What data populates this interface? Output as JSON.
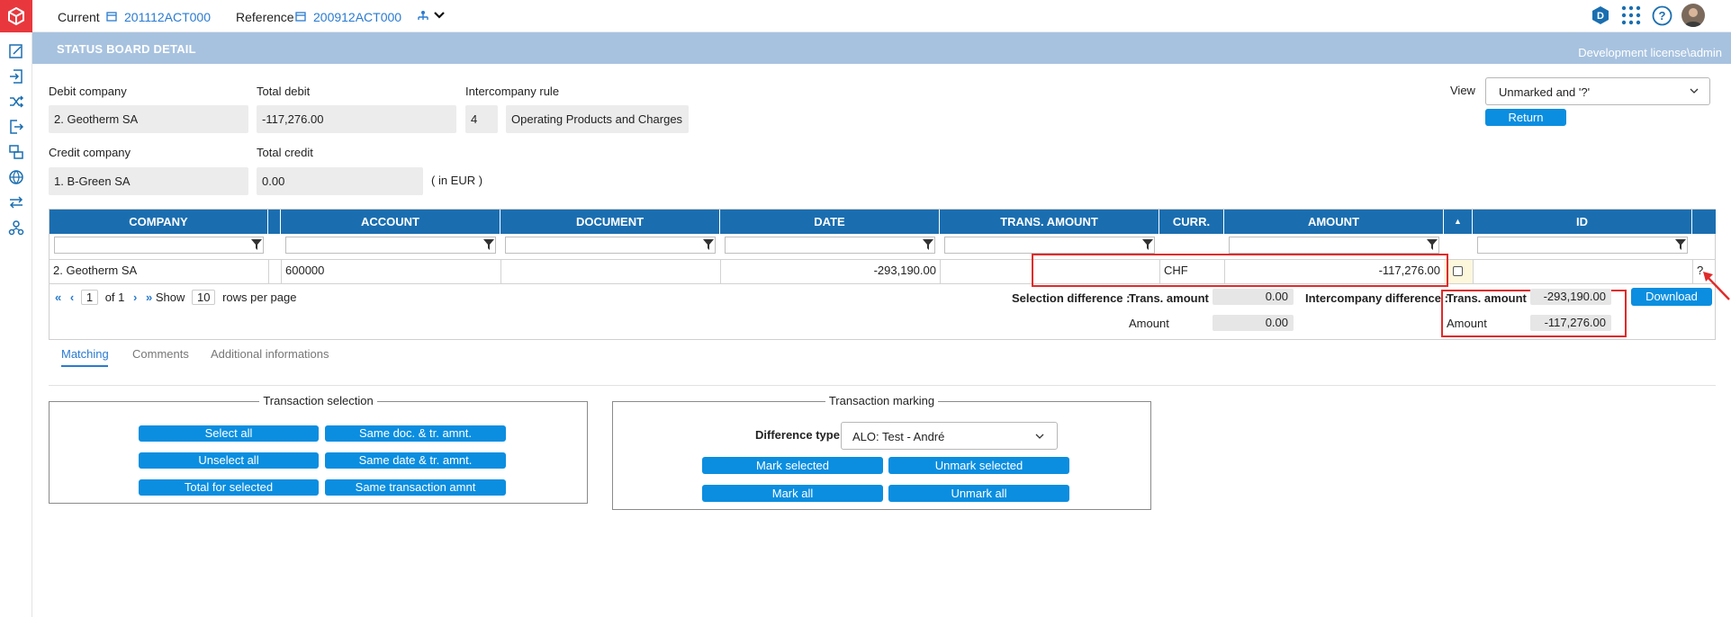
{
  "topbar": {
    "current_label": "Current",
    "current_value": "201112ACT000",
    "reference_label": "Reference",
    "reference_value": "200912ACT000",
    "badge_letter": "D"
  },
  "band": {
    "title": "STATUS BOARD DETAIL",
    "license": "Development license\\admin"
  },
  "form": {
    "debit_company_label": "Debit company",
    "debit_company_value": "2. Geotherm SA",
    "total_debit_label": "Total debit",
    "total_debit_value": "-117,276.00",
    "ic_rule_label": "Intercompany rule",
    "ic_rule_code": "4",
    "ic_rule_name": "Operating Products and Charges",
    "credit_company_label": "Credit company",
    "credit_company_value": "1. B-Green SA",
    "total_credit_label": "Total credit",
    "total_credit_value": "0.00",
    "currency_note": "( in EUR )",
    "view_label": "View",
    "view_value": "Unmarked and '?'",
    "return_label": "Return"
  },
  "grid": {
    "columns": [
      "COMPANY",
      "ACCOUNT",
      "DOCUMENT",
      "DATE",
      "TRANS. AMOUNT",
      "CURR.",
      "AMOUNT",
      "ID"
    ],
    "rows": [
      {
        "company": "2. Geotherm SA",
        "account": "600000",
        "document": "",
        "date": "",
        "trans_amount": "-293,190.00",
        "curr": "CHF",
        "amount": "-117,276.00",
        "id": "",
        "flag": "?"
      }
    ]
  },
  "pager": {
    "page": "1",
    "of_label": "of",
    "total": "1",
    "show_label": "Show",
    "rows": "10",
    "rows_label": "rows per page"
  },
  "diff": {
    "selection_label": "Selection difference :",
    "trans_amount_label": "Trans. amount",
    "sel_trans_amount": "0.00",
    "amount_label": "Amount",
    "sel_amount": "0.00",
    "ic_label": "Intercompany difference :",
    "ic_trans_amount": "-293,190.00",
    "ic_amount": "-117,276.00",
    "download_label": "Download"
  },
  "tabs": [
    "Matching",
    "Comments",
    "Additional informations"
  ],
  "selection": {
    "legend": "Transaction selection",
    "buttons": [
      "Select all",
      "Same doc. & tr. amnt.",
      "Unselect all",
      "Same date & tr. amnt.",
      "Total for selected",
      "Same transaction amnt"
    ]
  },
  "marking": {
    "legend": "Transaction marking",
    "difference_type_label": "Difference type",
    "difference_type_value": "ALO: Test - André",
    "buttons": [
      "Mark selected",
      "Unmark selected",
      "Mark all",
      "Unmark all"
    ]
  },
  "colors": {
    "accent": "#0b8ee0",
    "header": "#1a6eb0",
    "band": "#a7c2df",
    "logo": "#e8383d",
    "highlight": "#e02a2a"
  }
}
